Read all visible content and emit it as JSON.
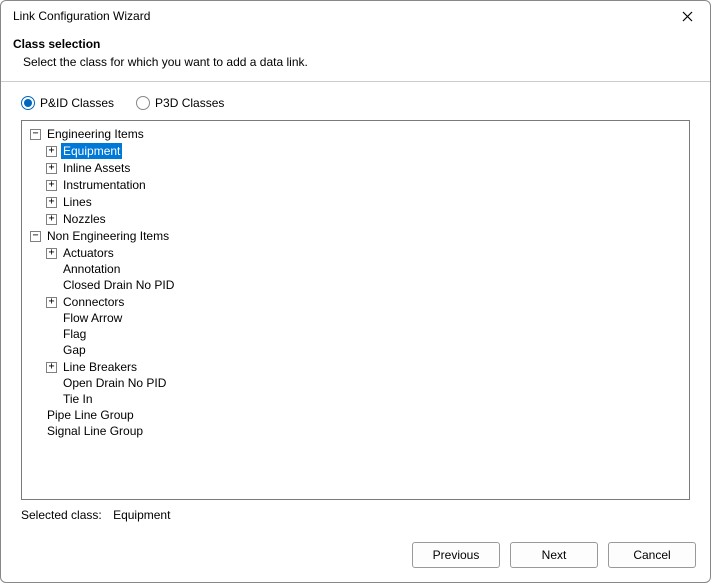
{
  "window": {
    "title": "Link Configuration Wizard"
  },
  "header": {
    "heading": "Class selection",
    "subtext": "Select the class for which you want to add a data link."
  },
  "radios": {
    "pid": {
      "label": "P&ID Classes",
      "checked": true
    },
    "p3d": {
      "label": "P3D Classes",
      "checked": false
    }
  },
  "tree": [
    {
      "depth": 0,
      "expander": "minus",
      "label": "Engineering Items"
    },
    {
      "depth": 1,
      "expander": "plus",
      "label": "Equipment",
      "selected": true
    },
    {
      "depth": 1,
      "expander": "plus",
      "label": "Inline Assets"
    },
    {
      "depth": 1,
      "expander": "plus",
      "label": "Instrumentation"
    },
    {
      "depth": 1,
      "expander": "plus",
      "label": "Lines"
    },
    {
      "depth": 1,
      "expander": "plus",
      "label": "Nozzles"
    },
    {
      "depth": 0,
      "expander": "minus",
      "label": "Non Engineering Items"
    },
    {
      "depth": 1,
      "expander": "plus",
      "label": "Actuators"
    },
    {
      "depth": 1,
      "expander": "none",
      "label": "Annotation"
    },
    {
      "depth": 1,
      "expander": "none",
      "label": "Closed Drain No PID"
    },
    {
      "depth": 1,
      "expander": "plus",
      "label": "Connectors"
    },
    {
      "depth": 1,
      "expander": "none",
      "label": "Flow Arrow"
    },
    {
      "depth": 1,
      "expander": "none",
      "label": "Flag"
    },
    {
      "depth": 1,
      "expander": "none",
      "label": "Gap"
    },
    {
      "depth": 1,
      "expander": "plus",
      "label": "Line Breakers"
    },
    {
      "depth": 1,
      "expander": "none",
      "label": "Open Drain No PID"
    },
    {
      "depth": 1,
      "expander": "none",
      "label": "Tie In"
    },
    {
      "depth": 0,
      "expander": "none",
      "label": "Pipe Line Group"
    },
    {
      "depth": 0,
      "expander": "none",
      "label": "Signal Line Group"
    }
  ],
  "selected": {
    "prefix": "Selected class:",
    "value": "Equipment"
  },
  "buttons": {
    "previous": "Previous",
    "next": "Next",
    "cancel": "Cancel"
  },
  "glyphs": {
    "plus": "+",
    "minus": "−"
  }
}
